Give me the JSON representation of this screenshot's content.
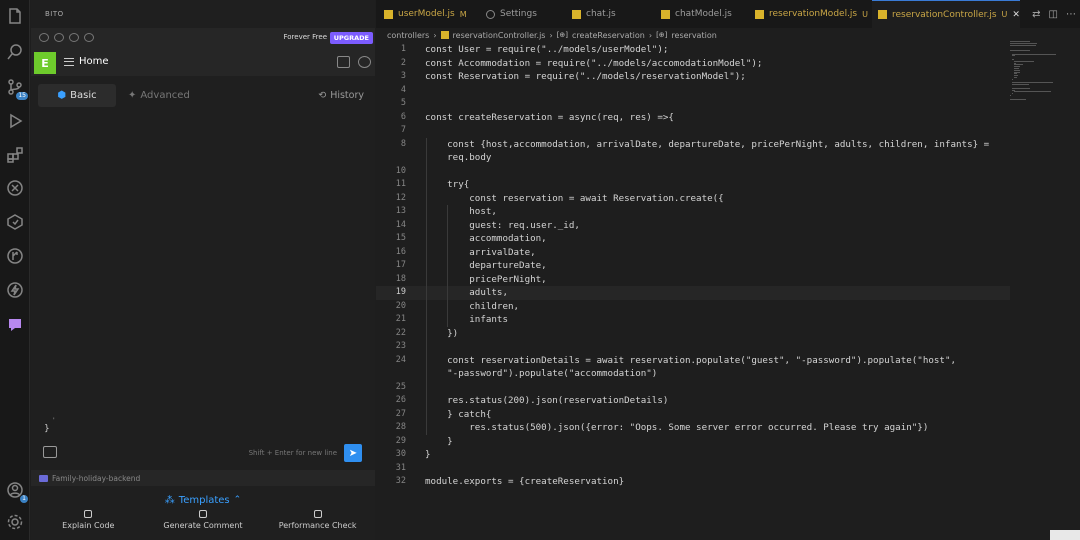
{
  "activity_bar": {
    "items": [
      {
        "name": "explorer-icon"
      },
      {
        "name": "search-icon"
      },
      {
        "name": "source-control-icon",
        "badge": "15"
      },
      {
        "name": "run-debug-icon"
      },
      {
        "name": "extensions-icon"
      },
      {
        "name": "remote-explorer-icon"
      },
      {
        "name": "testing-icon"
      },
      {
        "name": "git-graph-icon"
      },
      {
        "name": "thunder-client-icon"
      },
      {
        "name": "bito-icon"
      }
    ],
    "bottom": [
      {
        "name": "account-icon",
        "badge": "1"
      },
      {
        "name": "manage-gear-icon"
      }
    ]
  },
  "bito": {
    "title": "BITO",
    "forever_free": "Forever Free",
    "upgrade": "UPGRADE",
    "avatar_letter": "E",
    "home_label": "Home",
    "tabs": {
      "basic": "Basic",
      "advanced": "Advanced",
      "history": "History"
    },
    "chat_brace": "}",
    "chat_tick": "'",
    "input_hint": "Shift + Enter for new line",
    "workspace_folder": "Family-holiday-backend",
    "templates_label": "Templates",
    "actions": [
      "Explain Code",
      "Generate Comment",
      "Performance Check"
    ]
  },
  "editor": {
    "tabs": [
      {
        "label": "userModel.js",
        "mark": "M",
        "type": "js",
        "modified": true
      },
      {
        "label": "Settings",
        "mark": "",
        "type": "settings",
        "modified": false
      },
      {
        "label": "chat.js",
        "mark": "",
        "type": "js",
        "modified": false
      },
      {
        "label": "chatModel.js",
        "mark": "",
        "type": "js",
        "modified": false
      },
      {
        "label": "reservationModel.js",
        "mark": "U",
        "type": "js",
        "modified": true
      },
      {
        "label": "reservationController.js",
        "mark": "U",
        "type": "js",
        "modified": true,
        "active": true
      }
    ],
    "breadcrumb": [
      "controllers",
      "reservationController.js",
      "createReservation",
      "reservation"
    ],
    "current_line": 19,
    "lines": [
      {
        "n": "1",
        "t": "const User = require(\"../models/userModel\");"
      },
      {
        "n": "2",
        "t": "const Accommodation = require(\"../models/accomodationModel\");"
      },
      {
        "n": "3",
        "t": "const Reservation = require(\"../models/reservationModel\");"
      },
      {
        "n": "4",
        "t": ""
      },
      {
        "n": "5",
        "t": ""
      },
      {
        "n": "6",
        "t": "const createReservation = async(req, res) =>{"
      },
      {
        "n": "7",
        "t": ""
      },
      {
        "n": "8",
        "t": "    const {host,accommodation, arrivalDate, departureDate, pricePerNight, adults, children, infants} ="
      },
      {
        "n": "",
        "t": "    req.body"
      },
      {
        "n": "10",
        "t": ""
      },
      {
        "n": "11",
        "t": "    try{"
      },
      {
        "n": "12",
        "t": "        const reservation = await Reservation.create({"
      },
      {
        "n": "13",
        "t": "        host,"
      },
      {
        "n": "14",
        "t": "        guest: req.user._id,"
      },
      {
        "n": "15",
        "t": "        accommodation,"
      },
      {
        "n": "16",
        "t": "        arrivalDate,"
      },
      {
        "n": "17",
        "t": "        departureDate,"
      },
      {
        "n": "18",
        "t": "        pricePerNight,"
      },
      {
        "n": "19",
        "t": "        adults,"
      },
      {
        "n": "20",
        "t": "        children,"
      },
      {
        "n": "21",
        "t": "        infants"
      },
      {
        "n": "22",
        "t": "    })"
      },
      {
        "n": "23",
        "t": ""
      },
      {
        "n": "24",
        "t": "    const reservationDetails = await reservation.populate(\"guest\", \"-password\").populate(\"host\","
      },
      {
        "n": "",
        "t": "    \"-password\").populate(\"accommodation\")"
      },
      {
        "n": "25",
        "t": ""
      },
      {
        "n": "26",
        "t": "    res.status(200).json(reservationDetails)"
      },
      {
        "n": "27",
        "t": "    } catch{"
      },
      {
        "n": "28",
        "t": "        res.status(500).json({error: \"Oops. Some server error occurred. Please try again\"})"
      },
      {
        "n": "29",
        "t": "    }"
      },
      {
        "n": "30",
        "t": "}"
      },
      {
        "n": "31",
        "t": ""
      },
      {
        "n": "32",
        "t": "module.exports = {createReservation}"
      }
    ]
  },
  "colors": {
    "accent_blue": "#3aa0ff",
    "bito_purple": "#7c5cff",
    "avatar_green": "#6ecb2c",
    "modified_yellow": "#c9a646"
  }
}
